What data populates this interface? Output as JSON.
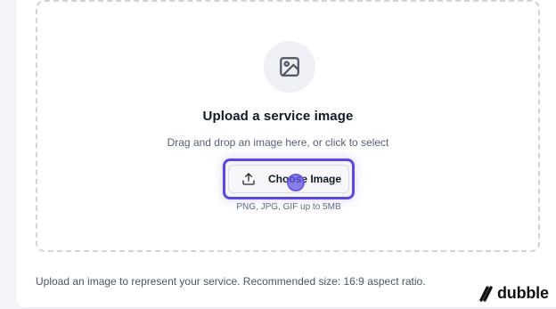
{
  "upload": {
    "title": "Upload a service image",
    "subtitle": "Drag and drop an image here, or click to select",
    "choose_button_label": "Choose Image",
    "formats": "PNG, JPG, GIF up to 5MB"
  },
  "help_text": "Upload an image to represent your service. Recommended size: 16:9 aspect ratio.",
  "brand": {
    "name": "dubble"
  },
  "colors": {
    "highlight": "#5b48e0",
    "dropzone_border": "#cfd3dc"
  }
}
